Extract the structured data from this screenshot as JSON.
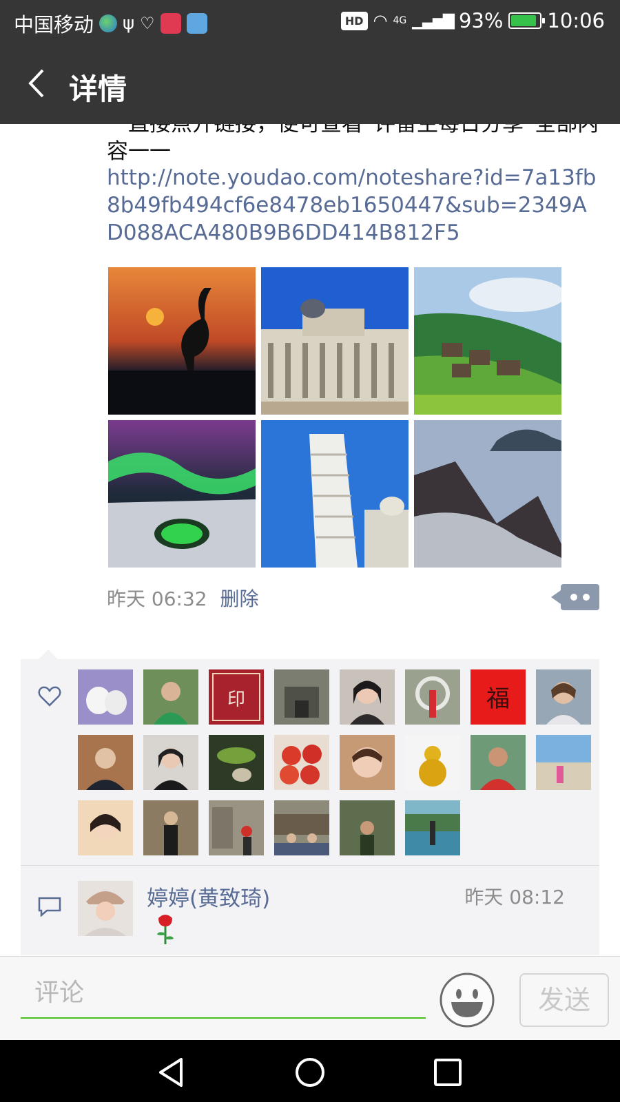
{
  "status_bar": {
    "carrier": "中国移动",
    "network": "4G",
    "battery": "93%",
    "time": "10:06",
    "hd": "HD"
  },
  "header": {
    "title": "详情"
  },
  "post": {
    "text": "一直接点开链接，便可查看“评留生每日分享”全部内容一一",
    "link": "http://note.youdao.com/noteshare?id=7a13fb8b49fb494cf6e8478eb1650447&sub=2349AD088ACA480B9B6DD414B812F5",
    "time": "昨天 06:32",
    "delete_label": "删除"
  },
  "likes": {
    "count": 22
  },
  "comment": {
    "name": "婷婷(黄致琦)",
    "time": "昨天 08:12",
    "content_icon": "rose-emoji"
  },
  "comment_bar": {
    "placeholder": "评论",
    "send_label": "发送"
  },
  "colors": {
    "header_bg": "#363636",
    "link": "#576b95",
    "accent_green": "#45c01a"
  }
}
